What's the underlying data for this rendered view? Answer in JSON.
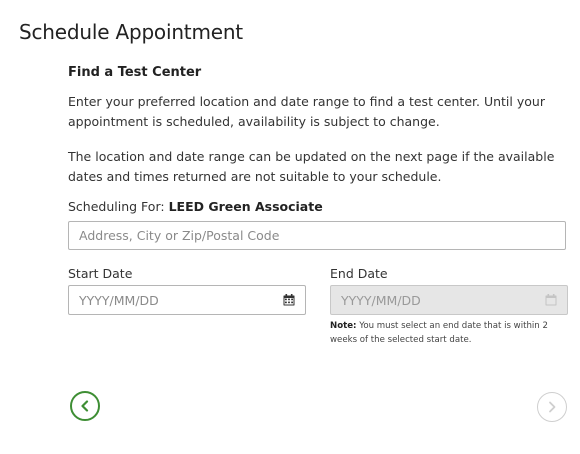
{
  "page": {
    "title": "Schedule Appointment"
  },
  "section": {
    "title": "Find a Test Center",
    "intro": "Enter your preferred location and date range to find a test center. Until your appointment is scheduled, availability is subject to change.",
    "update_note": "The location and date range can be updated on the next page if the available dates and times returned are not suitable to your schedule."
  },
  "scheduling": {
    "label": "Scheduling For:",
    "exam": "LEED Green Associate"
  },
  "address": {
    "placeholder": "Address, City or Zip/Postal Code",
    "value": ""
  },
  "start_date": {
    "label": "Start Date",
    "placeholder": "YYYY/MM/DD",
    "icon": "calendar-icon"
  },
  "end_date": {
    "label": "End Date",
    "placeholder": "YYYY/MM/DD",
    "icon": "calendar-icon",
    "disabled": true
  },
  "note": {
    "prefix": "Note:",
    "text": "You must select an end date that is within 2 weeks of the selected start date."
  },
  "nav": {
    "back_icon": "chevron-left-icon",
    "next_icon": "chevron-right-icon"
  },
  "colors": {
    "accent_green": "#3e8e34",
    "disabled_gray": "#cfcfcf",
    "disabled_field": "#e6e6e6"
  }
}
